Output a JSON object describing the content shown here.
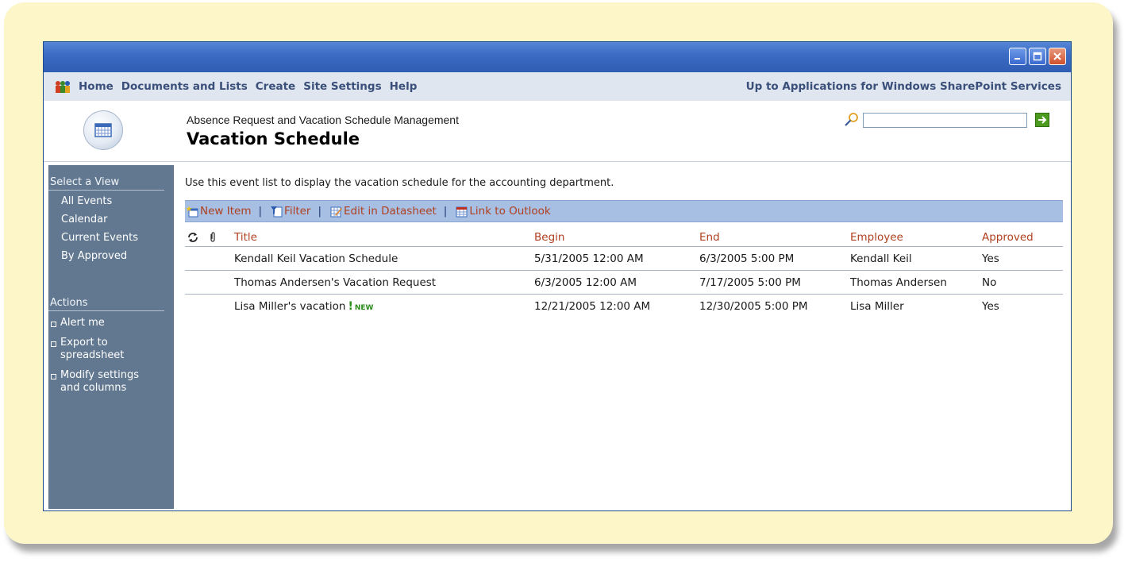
{
  "topnav": {
    "links": [
      "Home",
      "Documents and Lists",
      "Create",
      "Site Settings",
      "Help"
    ],
    "right_link": "Up to Applications for Windows SharePoint Services"
  },
  "header": {
    "subtitle": "Absence Request and Vacation Schedule Management",
    "title": "Vacation Schedule",
    "search_value": ""
  },
  "sidebar": {
    "views_heading": "Select a View",
    "views": [
      "All Events",
      "Calendar",
      "Current Events",
      "By Approved"
    ],
    "actions_heading": "Actions",
    "actions": [
      "Alert me",
      "Export to spreadsheet",
      "Modify settings and columns"
    ]
  },
  "main": {
    "description": "Use this event list to display the vacation schedule for the accounting department.",
    "toolbar": {
      "new_item": "New Item",
      "filter": "Filter",
      "edit_datasheet": "Edit in Datasheet",
      "link_outlook": "Link to Outlook",
      "separator": "|"
    },
    "columns": [
      "Title",
      "Begin",
      "End",
      "Employee",
      "Approved"
    ],
    "rows": [
      {
        "title": "Kendall Keil Vacation Schedule",
        "begin": "5/31/2005 12:00 AM",
        "end": "6/3/2005 5:00 PM",
        "employee": "Kendall Keil",
        "approved": "Yes",
        "new": ""
      },
      {
        "title": "Thomas Andersen's Vacation Request",
        "begin": "6/3/2005 12:00 AM",
        "end": "7/17/2005 5:00 PM",
        "employee": "Thomas Andersen",
        "approved": "No",
        "new": ""
      },
      {
        "title": "Lisa Miller's vacation",
        "begin": "12/21/2005 12:00 AM",
        "end": "12/30/2005 5:00 PM",
        "employee": "Lisa Miller",
        "approved": "Yes",
        "new": "NEW"
      }
    ]
  },
  "colors": {
    "frame_bg": "#fcf6c8",
    "titlebar": "#3d6cc4",
    "sidebar_bg": "#627890",
    "toolbar_bg": "#a6bfe3",
    "link_red": "#b04020"
  }
}
